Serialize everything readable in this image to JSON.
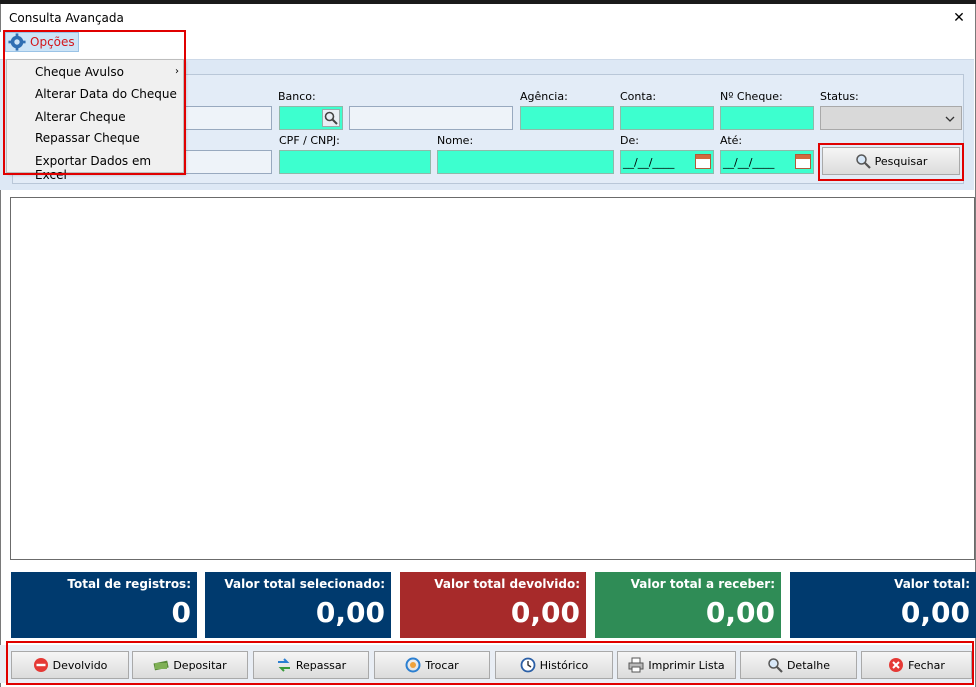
{
  "window": {
    "title": "Consulta Avançada",
    "close": "✕"
  },
  "menu": {
    "opcoes_label": "Opções",
    "items": [
      {
        "label": "Cheque Avulso",
        "submenu": true
      },
      {
        "label": "Alterar Data do Cheque"
      },
      {
        "label": "Alterar Cheque"
      },
      {
        "label": "Repassar Cheque"
      },
      {
        "label": "Exportar Dados em Excel"
      }
    ]
  },
  "filters": {
    "banco_label": "Banco:",
    "agencia_label": "Agência:",
    "conta_label": "Conta:",
    "ncheque_label": "Nº Cheque:",
    "status_label": "Status:",
    "cpf_label": "CPF / CNPJ:",
    "nome_label": "Nome:",
    "de_label": "De:",
    "ate_label": "Até:",
    "de_value": "__/__/____",
    "ate_value": "__/__/____",
    "pesquisar_label": "Pesquisar"
  },
  "summary": [
    {
      "label": "Total de registros:",
      "value": "0",
      "color": "#003a6e"
    },
    {
      "label": "Valor total selecionado:",
      "value": "0,00",
      "color": "#003a6e"
    },
    {
      "label": "Valor total devolvido:",
      "value": "0,00",
      "color": "#a72a2a"
    },
    {
      "label": "Valor total a receber:",
      "value": "0,00",
      "color": "#2f8c56"
    },
    {
      "label": "Valor total:",
      "value": "0,00",
      "color": "#003a6e"
    }
  ],
  "actions": [
    {
      "label": "Devolvido",
      "icon": "no-entry-icon"
    },
    {
      "label": "Depositar",
      "icon": "money-icon"
    },
    {
      "label": "Repassar",
      "icon": "swap-arrows-icon"
    },
    {
      "label": "Trocar",
      "icon": "exchange-icon"
    },
    {
      "label": "Histórico",
      "icon": "clock-icon"
    },
    {
      "label": "Imprimir Lista",
      "icon": "printer-icon"
    },
    {
      "label": "Detalhe",
      "icon": "magnifier-icon"
    },
    {
      "label": "Fechar",
      "icon": "close-circle-icon"
    }
  ],
  "colors": {
    "accent_red": "#e00000",
    "field_green": "#3dffcf"
  }
}
